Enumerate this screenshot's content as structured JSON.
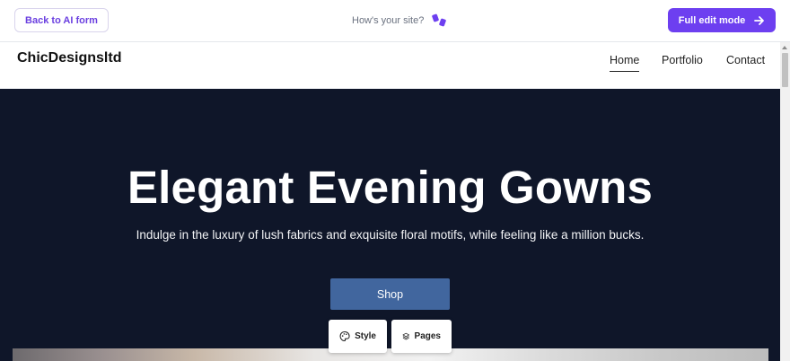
{
  "editor_bar": {
    "back_label": "Back to AI form",
    "feedback_question": "How's your site?",
    "full_edit_label": "Full edit mode",
    "accent_color": "#6d3ff0"
  },
  "site": {
    "brand": "ChicDesignsltd",
    "nav": [
      {
        "label": "Home",
        "active": true
      },
      {
        "label": "Portfolio",
        "active": false
      },
      {
        "label": "Contact",
        "active": false
      }
    ]
  },
  "hero": {
    "title": "Elegant Evening Gowns",
    "subtitle": "Indulge in the luxury of lush fabrics and exquisite floral motifs, while feeling like a million bucks.",
    "cta_label": "Shop",
    "background_color": "#0f1629",
    "cta_color": "#41669e"
  },
  "tools": {
    "style_label": "Style",
    "style_icon": "palette-icon",
    "pages_label": "Pages",
    "pages_icon": "layers-icon"
  }
}
